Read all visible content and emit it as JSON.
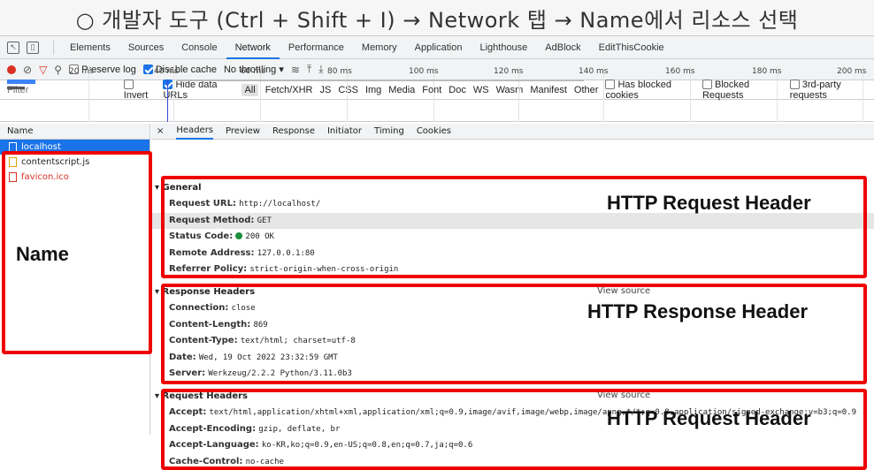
{
  "caption": "○ 개발자 도구 (Ctrl + Shift + I) → Network 탭 → Name에서 리소스 선택",
  "tabs": [
    "Elements",
    "Sources",
    "Console",
    "Network",
    "Performance",
    "Memory",
    "Application",
    "Lighthouse",
    "AdBlock",
    "EditThisCookie"
  ],
  "toolbar": {
    "preserve_log": "Preserve log",
    "disable_cache": "Disable cache",
    "throttling": "No throttling"
  },
  "filterbar": {
    "placeholder": "Filter",
    "invert": "Invert",
    "hide_data_urls": "Hide data URLs",
    "types": [
      "All",
      "Fetch/XHR",
      "JS",
      "CSS",
      "Img",
      "Media",
      "Font",
      "Doc",
      "WS",
      "Wasm",
      "Manifest",
      "Other"
    ],
    "blocked_cookies": "Has blocked cookies",
    "blocked_requests": "Blocked Requests",
    "third_party": "3rd-party requests"
  },
  "overview_ticks": [
    "20 ms",
    "40 ms",
    "60 ms",
    "80 ms",
    "100 ms",
    "120 ms",
    "140 ms",
    "160 ms",
    "180 ms",
    "200 ms"
  ],
  "name_pane": {
    "header": "Name",
    "items": [
      "localhost",
      "contentscript.js",
      "favicon.ico"
    ]
  },
  "detail_tabs": [
    "×",
    "Headers",
    "Preview",
    "Response",
    "Initiator",
    "Timing",
    "Cookies"
  ],
  "general": {
    "title": "General",
    "rows": [
      {
        "k": "Request URL:",
        "v": "http://localhost/"
      },
      {
        "k": "Request Method:",
        "v": "GET"
      },
      {
        "k": "Status Code:",
        "v": "200 OK"
      },
      {
        "k": "Remote Address:",
        "v": "127.0.0.1:80"
      },
      {
        "k": "Referrer Policy:",
        "v": "strict-origin-when-cross-origin"
      }
    ]
  },
  "response_headers": {
    "title": "Response Headers",
    "view_source": "View source",
    "rows": [
      {
        "k": "Connection:",
        "v": "close"
      },
      {
        "k": "Content-Length:",
        "v": "869"
      },
      {
        "k": "Content-Type:",
        "v": "text/html; charset=utf-8"
      },
      {
        "k": "Date:",
        "v": "Wed, 19 Oct 2022 23:32:59 GMT"
      },
      {
        "k": "Server:",
        "v": "Werkzeug/2.2.2 Python/3.11.0b3"
      }
    ]
  },
  "request_headers": {
    "title": "Request Headers",
    "view_source": "View source",
    "rows": [
      {
        "k": "Accept:",
        "v": "text/html,application/xhtml+xml,application/xml;q=0.9,image/avif,image/webp,image/apng,*/*;q=0.8,application/signed-exchange;v=b3;q=0.9"
      },
      {
        "k": "Accept-Encoding:",
        "v": "gzip, deflate, br"
      },
      {
        "k": "Accept-Language:",
        "v": "ko-KR,ko;q=0.9,en-US;q=0.8,en;q=0.7,ja;q=0.6"
      },
      {
        "k": "Cache-Control:",
        "v": "no-cache"
      }
    ]
  },
  "annotations": {
    "name": "Name",
    "req1": "HTTP Request Header",
    "resp": "HTTP Response Header",
    "req2": "HTTP Request Header"
  }
}
